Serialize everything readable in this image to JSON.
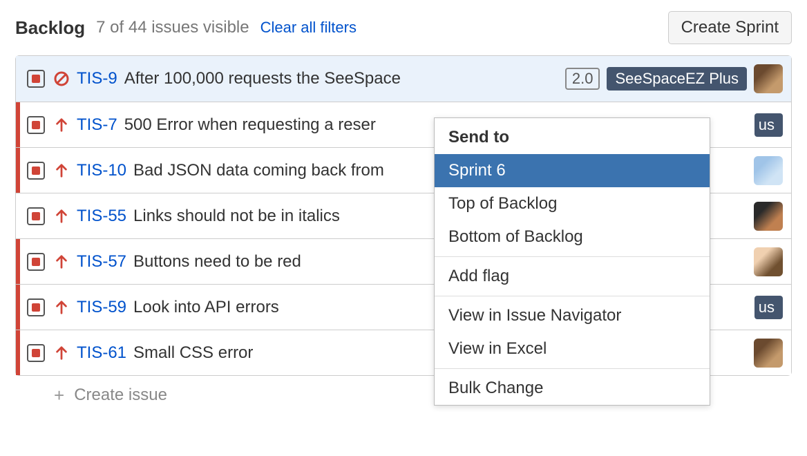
{
  "header": {
    "title": "Backlog",
    "count_text": "7 of 44 issues visible",
    "clear_filters": "Clear all filters",
    "create_sprint": "Create Sprint"
  },
  "issues": [
    {
      "key": "TIS-9",
      "summary": "After 100,000 requests the SeeSpace",
      "priority": "blocker",
      "stripe": false,
      "selected": true,
      "version_badge": "2.0",
      "epic_badge": "SeeSpaceEZ Plus",
      "avatar": "a1"
    },
    {
      "key": "TIS-7",
      "summary": "500 Error when requesting a reser",
      "priority": "high",
      "stripe": true,
      "selected": false,
      "epic_badge_partial": "us",
      "avatar": null
    },
    {
      "key": "TIS-10",
      "summary": "Bad JSON data coming back from",
      "priority": "high",
      "stripe": true,
      "selected": false,
      "avatar": "a2"
    },
    {
      "key": "TIS-55",
      "summary": "Links should not be in italics",
      "priority": "high",
      "stripe": false,
      "selected": false,
      "avatar": "a3"
    },
    {
      "key": "TIS-57",
      "summary": "Buttons need to be red",
      "priority": "high",
      "stripe": true,
      "selected": false,
      "avatar": "a4"
    },
    {
      "key": "TIS-59",
      "summary": "Look into API errors",
      "priority": "high",
      "stripe": true,
      "selected": false,
      "epic_badge_partial": "us",
      "avatar": null
    },
    {
      "key": "TIS-61",
      "summary": "Small CSS error",
      "priority": "high",
      "stripe": true,
      "selected": false,
      "avatar": "a1"
    }
  ],
  "create_issue": "Create issue",
  "context_menu": {
    "title": "Send to",
    "items": [
      {
        "label": "Sprint 6",
        "selected": true
      },
      {
        "label": "Top of Backlog",
        "selected": false
      },
      {
        "label": "Bottom of Backlog",
        "selected": false
      }
    ],
    "items2": [
      {
        "label": "Add flag"
      }
    ],
    "items3": [
      {
        "label": "View in Issue Navigator"
      },
      {
        "label": "View in Excel"
      }
    ],
    "items4": [
      {
        "label": "Bulk Change"
      }
    ]
  }
}
